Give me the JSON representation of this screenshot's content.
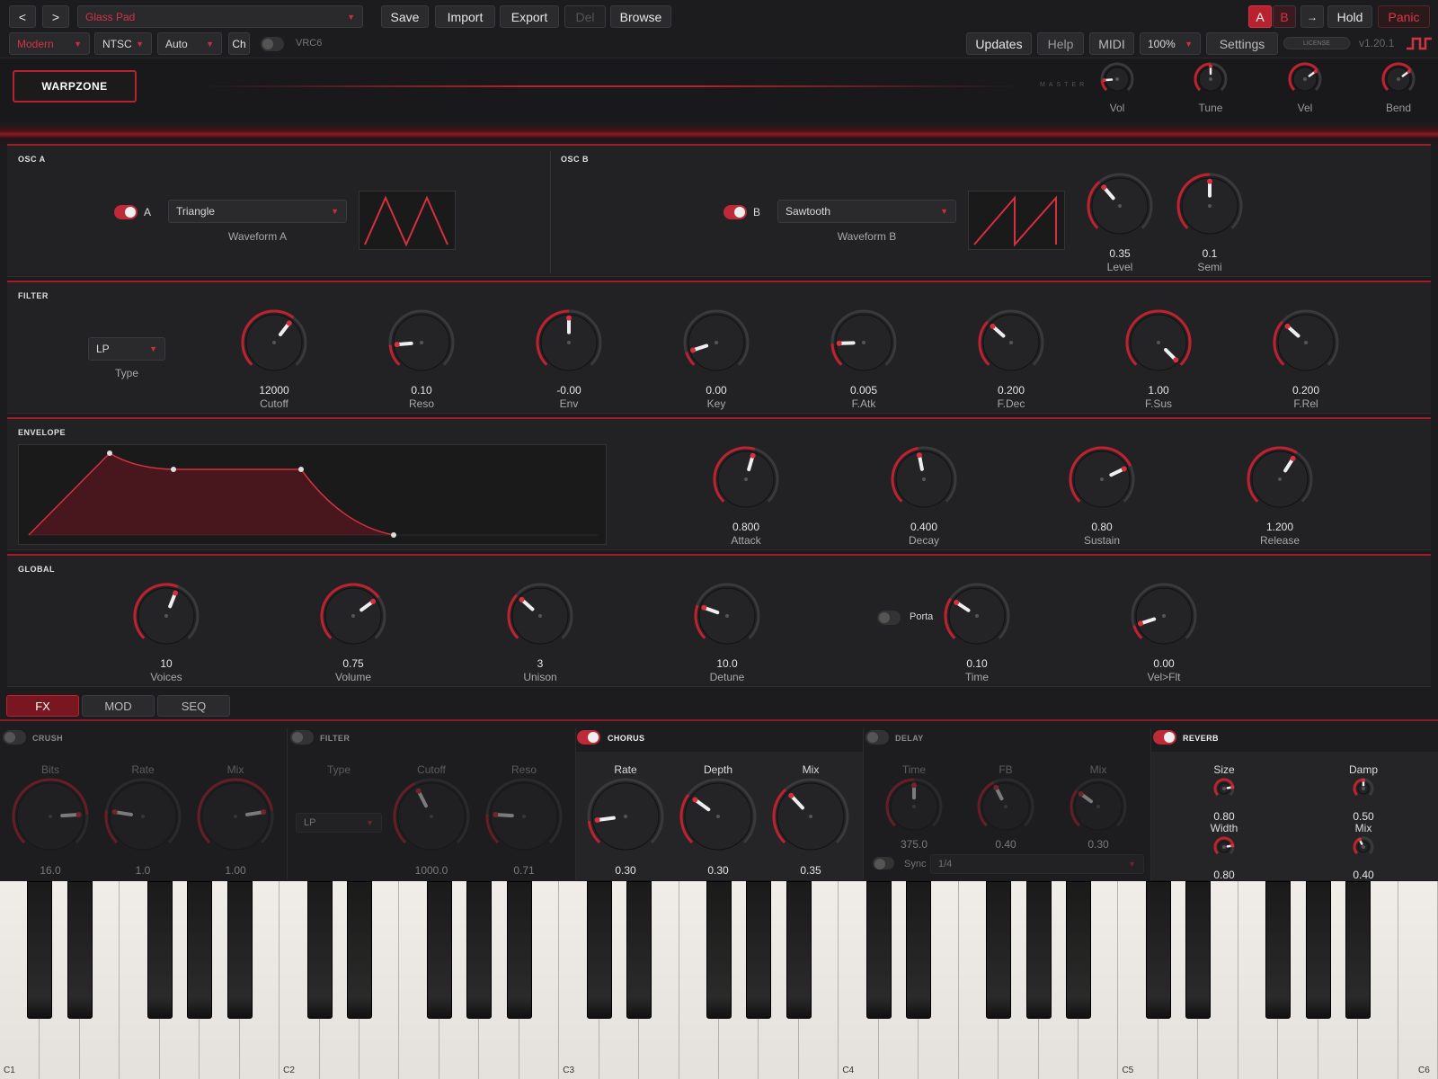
{
  "topbar": {
    "prev": "<",
    "next": ">",
    "preset": "Glass Pad",
    "save": "Save",
    "import": "Import",
    "export": "Export",
    "del": "Del",
    "browse": "Browse",
    "ab_a": "A",
    "ab_b": "B",
    "copy": "→",
    "hold": "Hold",
    "panic": "Panic"
  },
  "bar2": {
    "mode": "Modern",
    "region": "NTSC",
    "auto": "Auto",
    "ch": "Ch",
    "vrc6": "VRC6",
    "updates": "Updates",
    "help": "Help",
    "midi": "MIDI",
    "zoom": "100%",
    "settings": "Settings",
    "license": "LICENSE",
    "version": "v1.20.1"
  },
  "header": {
    "patch_name": "WARPZONE",
    "master": "MASTER",
    "knobs": [
      {
        "label": "Vol",
        "level": 0.15
      },
      {
        "label": "Tune",
        "level": 0.5
      },
      {
        "label": "Vel",
        "level": 0.7
      },
      {
        "label": "Bend",
        "level": 0.7
      }
    ]
  },
  "osc_a": {
    "title": "OSC A",
    "toggle_label": "A",
    "waveform": "Triangle",
    "waveform_label": "Waveform A"
  },
  "osc_b": {
    "title": "OSC B",
    "toggle_label": "B",
    "waveform": "Sawtooth",
    "waveform_label": "Waveform B",
    "knobs": [
      {
        "value": "0.35",
        "label": "Level",
        "level": 0.35
      },
      {
        "value": "0.1",
        "label": "Semi",
        "level": 0.5
      }
    ]
  },
  "filter": {
    "title": "FILTER",
    "type": "LP",
    "type_label": "Type",
    "knobs": [
      {
        "value": "12000",
        "label": "Cutoff",
        "level": 0.64
      },
      {
        "value": "0.10",
        "label": "Reso",
        "level": 0.15
      },
      {
        "value": "-0.00",
        "label": "Env",
        "level": 0.5
      },
      {
        "value": "0.00",
        "label": "Key",
        "level": 0.1
      },
      {
        "value": "0.005",
        "label": "F.Atk",
        "level": 0.16
      },
      {
        "value": "0.200",
        "label": "F.Dec",
        "level": 0.32
      },
      {
        "value": "1.00",
        "label": "F.Sus",
        "level": 1.0
      },
      {
        "value": "0.200",
        "label": "F.Rel",
        "level": 0.32
      }
    ]
  },
  "envelope": {
    "title": "ENVELOPE",
    "knobs": [
      {
        "value": "0.800",
        "label": "Attack",
        "level": 0.56
      },
      {
        "value": "0.400",
        "label": "Decay",
        "level": 0.46
      },
      {
        "value": "0.80",
        "label": "Sustain",
        "level": 0.74
      },
      {
        "value": "1.200",
        "label": "Release",
        "level": 0.62
      }
    ]
  },
  "global": {
    "title": "GLOBAL",
    "porta": "Porta",
    "knobs": [
      {
        "value": "10",
        "label": "Voices",
        "level": 0.58
      },
      {
        "value": "0.75",
        "label": "Volume",
        "level": 0.7
      },
      {
        "value": "3",
        "label": "Unison",
        "level": 0.32
      },
      {
        "value": "10.0",
        "label": "Detune",
        "level": 0.24
      },
      {
        "value": "0.10",
        "label": "Time",
        "level": 0.29
      },
      {
        "value": "0.00",
        "label": "Vel>Flt",
        "level": 0.1
      }
    ]
  },
  "tabs": [
    "FX",
    "MOD",
    "SEQ"
  ],
  "fx": {
    "crush": {
      "name": "CRUSH",
      "labels": [
        "Bits",
        "Rate",
        "Mix"
      ],
      "values": [
        "16.0",
        "1.0",
        "1.00"
      ]
    },
    "filter": {
      "name": "FILTER",
      "labels": [
        "Type",
        "Cutoff",
        "Reso"
      ],
      "type": "LP",
      "values": [
        "1000.0",
        "0.71"
      ]
    },
    "chorus": {
      "name": "CHORUS",
      "labels": [
        "Rate",
        "Depth",
        "Mix"
      ],
      "values": [
        "0.30",
        "0.30",
        "0.35"
      ]
    },
    "delay": {
      "name": "DELAY",
      "labels": [
        "Time",
        "FB",
        "Mix"
      ],
      "values": [
        "375.0",
        "0.40",
        "0.30"
      ],
      "sync": "Sync",
      "division": "1/4"
    },
    "reverb": {
      "name": "REVERB",
      "labels": [
        "Size",
        "Damp",
        "Width",
        "Mix"
      ],
      "values": [
        "0.80",
        "0.50",
        "0.80",
        "0.40"
      ]
    }
  },
  "keyboard": {
    "octave_labels": [
      "C1",
      "C2",
      "C3",
      "C4",
      "C5",
      "C6"
    ]
  }
}
